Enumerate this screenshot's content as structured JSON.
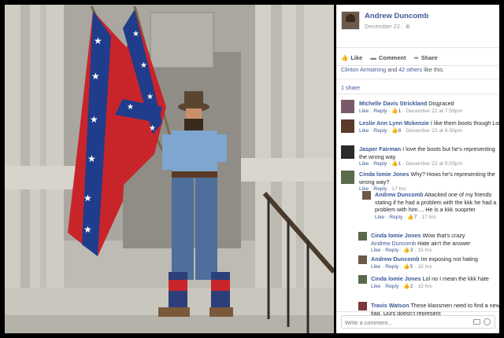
{
  "post": {
    "author": "Andrew Duncomb",
    "date": "December 22 · ⊕",
    "actions": {
      "like": "Like",
      "comment": "Comment",
      "share": "Share"
    },
    "likes_line_a": "Clinton Armstrong",
    "likes_line_b": " and ",
    "likes_line_c": "42 others",
    "likes_line_d": " like this.",
    "shares": "1 share"
  },
  "comments": [
    {
      "author": "Michelle Davis Strickland",
      "text": " Disgraced",
      "likes": "1",
      "date": "December 22 at 7:59pm",
      "avatar_color": "#7a5a6a"
    },
    {
      "author": "Leslie Ann Lynn Mckenzie",
      "text": " I like them boots though Lol",
      "likes": "8",
      "date": "December 22 at 8:33pm",
      "avatar_color": "#5a3a2a"
    },
    {
      "author": "Jasper Fairman",
      "text": " I love the boots but he's representing the wrong way",
      "likes": "1",
      "date": "December 22 at 9:03pm",
      "avatar_color": "#2a2a2a"
    },
    {
      "author": "Cinda lomie Jones",
      "text": " Why? Hows he's representing the wrong way?",
      "likes": "",
      "date": "17 hrs",
      "avatar_color": "#5a6a4a"
    }
  ],
  "replies": [
    {
      "author": "Andrew Duncomb",
      "text": " Attacked one of my friends stating if he had a problem with the kkk he had a problem with him ... He is a kkk suoprter",
      "likes": "7",
      "date": "17 hrs",
      "avatar_color": "#6b5a4a"
    },
    {
      "author": "Cinda lomie Jones",
      "text": " Wow that's crazy",
      "subtext": "Andrew Duncomb",
      "subtext2": " Hate ain't the answer",
      "likes": "3",
      "date": "15 hrs",
      "avatar_color": "#5a6a4a"
    },
    {
      "author": "Andrew Duncomb",
      "text": " Im exposing not hating",
      "likes": "5",
      "date": "15 hrs",
      "avatar_color": "#6b5a4a"
    },
    {
      "author": "Cinda lomie Jones",
      "text": " Lol no I mean the kkk hate",
      "likes": "2",
      "date": "15 hrs",
      "avatar_color": "#5a6a4a"
    },
    {
      "author": "Travis Watson",
      "text": " These klansmen need to find a new flag. Ours doesn't represent",
      "avatar_color": "#7a3a3a"
    }
  ],
  "labels": {
    "like": "Like",
    "reply": "Reply",
    "dot": " · ",
    "thumb": "👍"
  },
  "write_comment_placeholder": "Write a comment..."
}
